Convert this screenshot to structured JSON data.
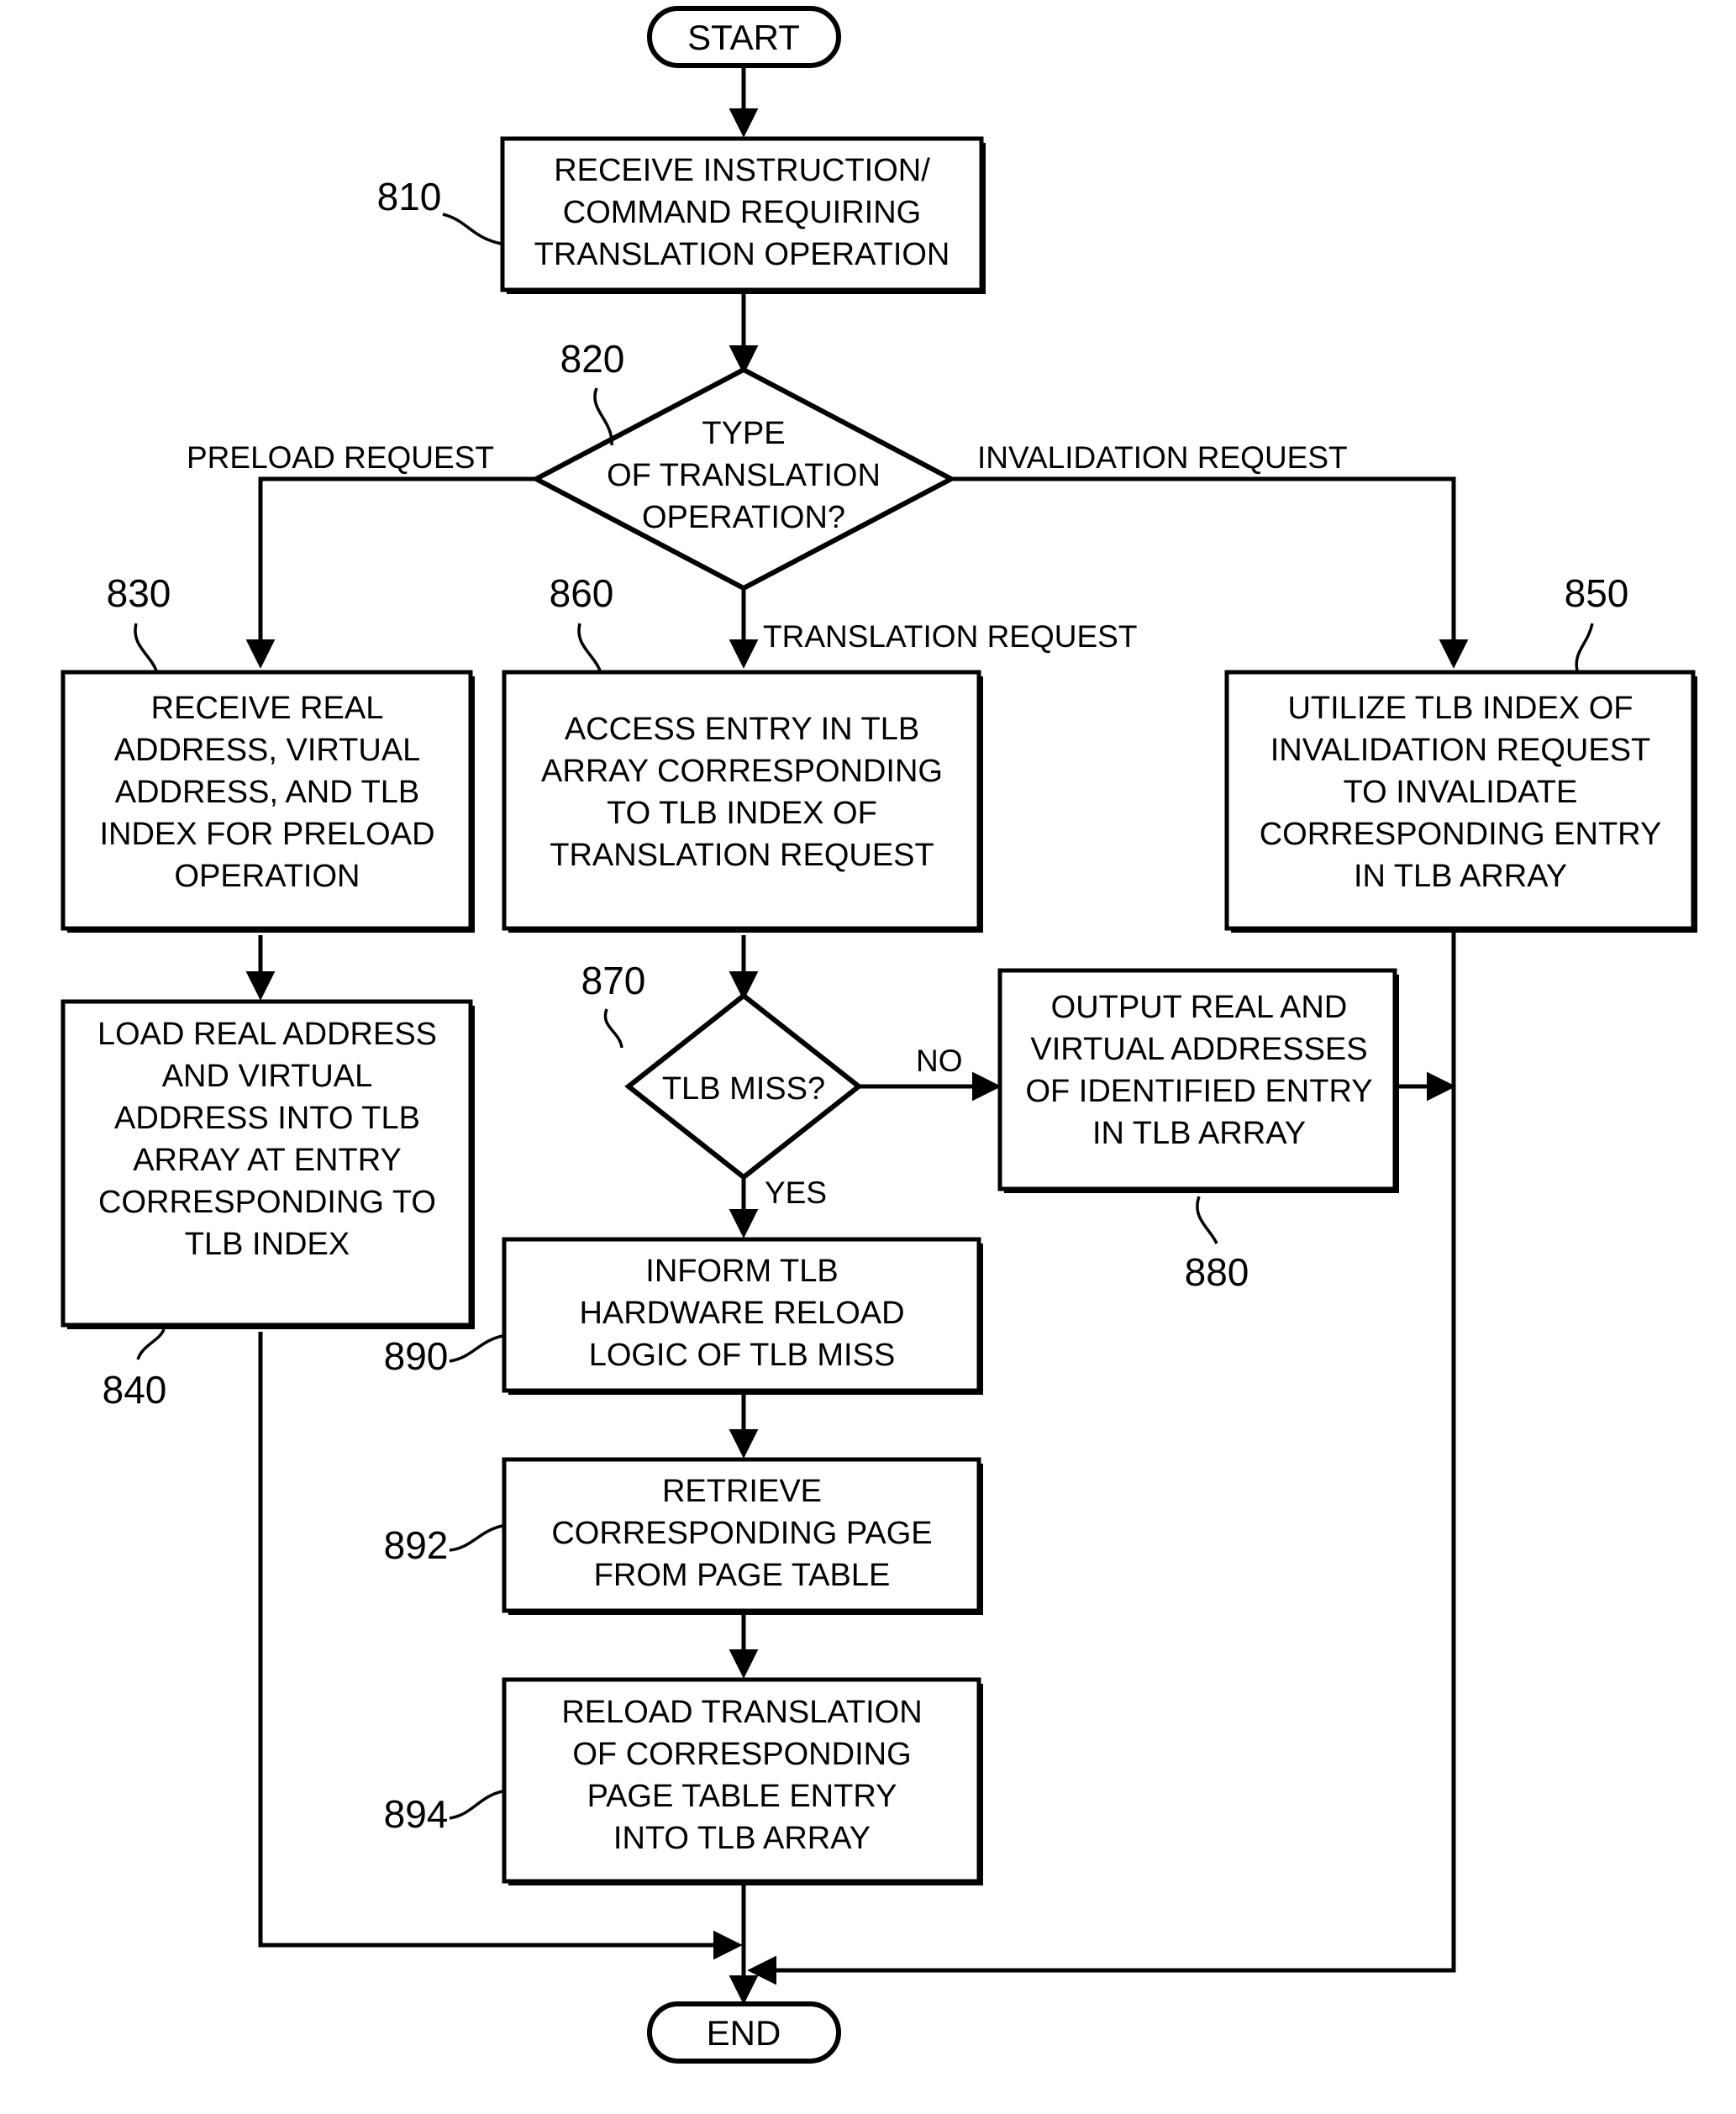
{
  "diagram": {
    "type": "flowchart",
    "title": "TLB translation operation flowchart",
    "terminals": {
      "start": "START",
      "end": "END"
    },
    "nodes": [
      {
        "id": "810",
        "ref": "810",
        "shape": "process",
        "lines": [
          "RECEIVE INSTRUCTION/",
          "COMMAND REQUIRING",
          "TRANSLATION OPERATION"
        ]
      },
      {
        "id": "820",
        "ref": "820",
        "shape": "decision",
        "lines": [
          "TYPE",
          "OF TRANSLATION",
          "OPERATION?"
        ]
      },
      {
        "id": "830",
        "ref": "830",
        "shape": "process",
        "lines": [
          "RECEIVE REAL",
          "ADDRESS, VIRTUAL",
          "ADDRESS, AND TLB",
          "INDEX FOR PRELOAD",
          "OPERATION"
        ]
      },
      {
        "id": "840",
        "ref": "840",
        "shape": "process",
        "lines": [
          "LOAD REAL ADDRESS",
          "AND VIRTUAL",
          "ADDRESS INTO TLB",
          "ARRAY AT ENTRY",
          "CORRESPONDING TO",
          "TLB INDEX"
        ]
      },
      {
        "id": "850",
        "ref": "850",
        "shape": "process",
        "lines": [
          "UTILIZE TLB INDEX OF",
          "INVALIDATION REQUEST",
          "TO INVALIDATE",
          "CORRESPONDING ENTRY",
          "IN TLB ARRAY"
        ]
      },
      {
        "id": "860",
        "ref": "860",
        "shape": "process",
        "lines": [
          "ACCESS ENTRY IN TLB",
          "ARRAY CORRESPONDING",
          "TO TLB INDEX OF",
          "TRANSLATION REQUEST"
        ]
      },
      {
        "id": "870",
        "ref": "870",
        "shape": "decision",
        "lines": [
          "TLB MISS?"
        ]
      },
      {
        "id": "880",
        "ref": "880",
        "shape": "process",
        "lines": [
          "OUTPUT REAL AND",
          "VIRTUAL ADDRESSES",
          "OF IDENTIFIED ENTRY",
          "IN TLB ARRAY"
        ]
      },
      {
        "id": "890",
        "ref": "890",
        "shape": "process",
        "lines": [
          "INFORM TLB",
          "HARDWARE RELOAD",
          "LOGIC OF TLB MISS"
        ]
      },
      {
        "id": "892",
        "ref": "892",
        "shape": "process",
        "lines": [
          "RETRIEVE",
          "CORRESPONDING PAGE",
          "FROM PAGE TABLE"
        ]
      },
      {
        "id": "894",
        "ref": "894",
        "shape": "process",
        "lines": [
          "RELOAD TRANSLATION",
          "OF CORRESPONDING",
          "PAGE TABLE ENTRY",
          "INTO TLB ARRAY"
        ]
      }
    ],
    "edge_labels": {
      "preload_request": "PRELOAD REQUEST",
      "invalidation_request": "INVALIDATION REQUEST",
      "translation_request": "TRANSLATION REQUEST",
      "no": "NO",
      "yes": "YES"
    },
    "colors": {
      "stroke": "#000000",
      "fill": "#ffffff"
    }
  }
}
